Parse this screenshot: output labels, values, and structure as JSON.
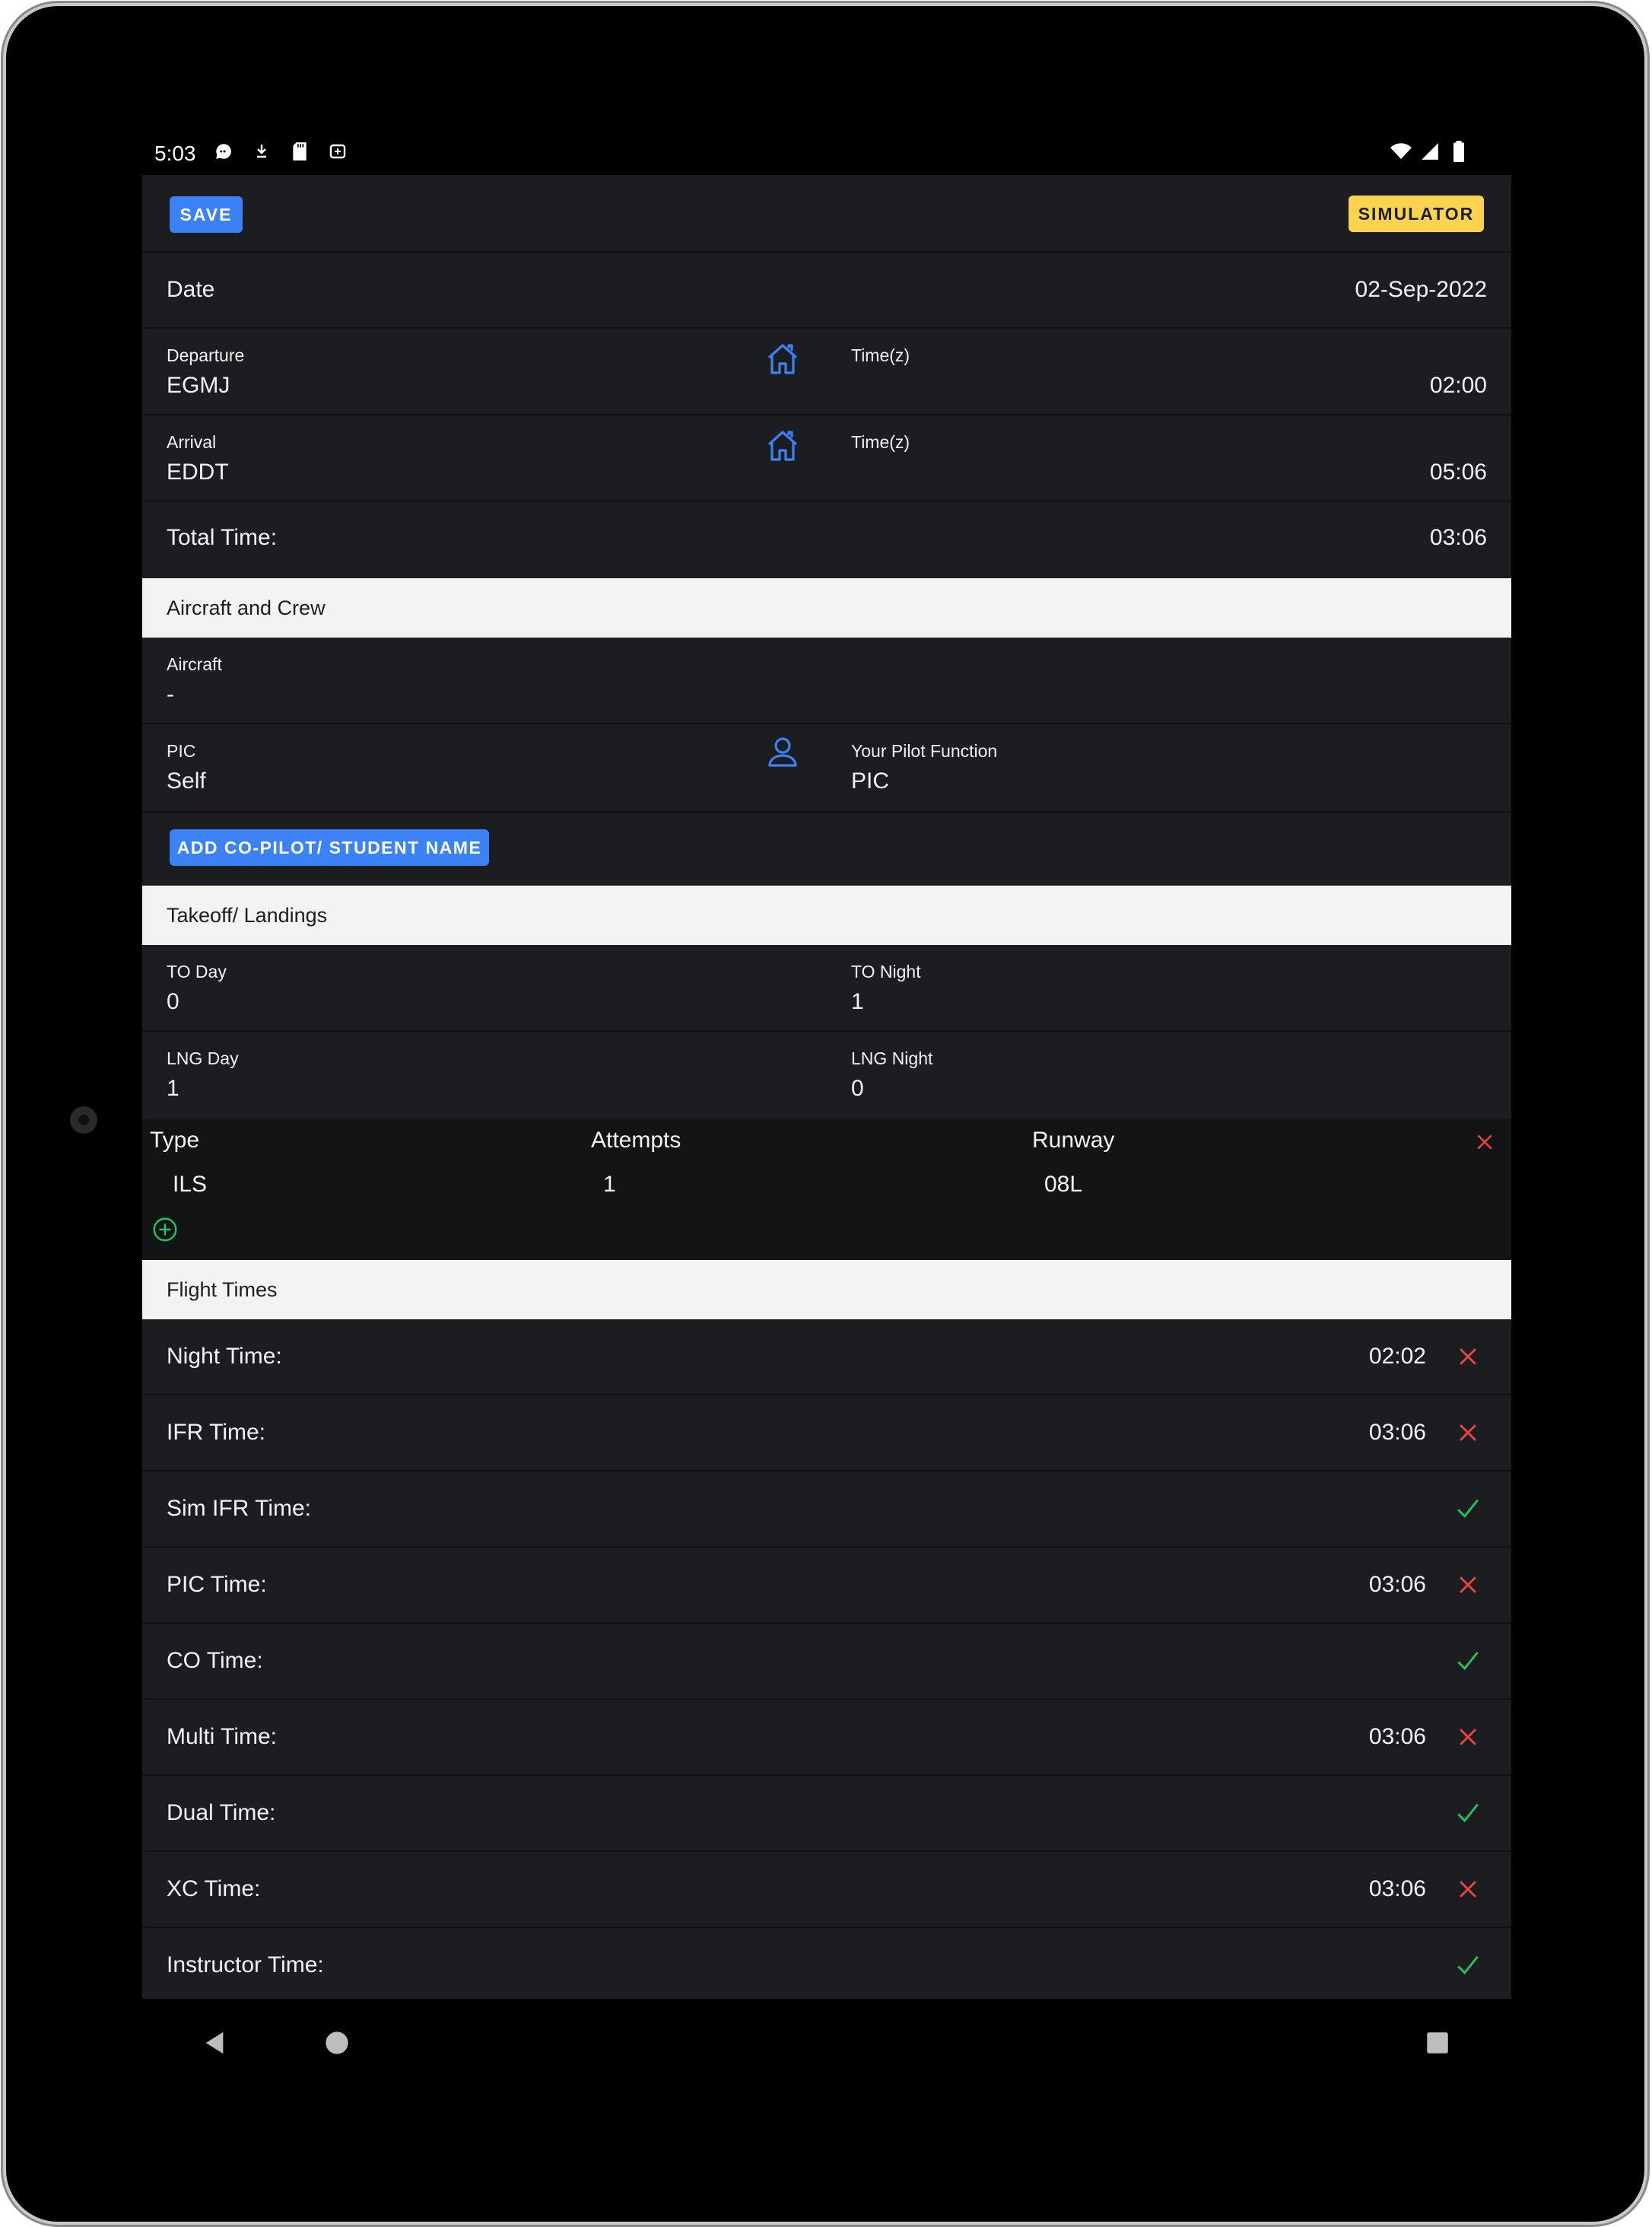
{
  "status_bar": {
    "time": "5:03",
    "icons": [
      "chat-icon",
      "download-icon",
      "sd-card-icon",
      "notification-icon"
    ],
    "right_icons": [
      "wifi-icon",
      "signal-icon",
      "battery-icon"
    ]
  },
  "toolbar": {
    "save_label": "SAVE",
    "simulator_label": "SIMULATOR"
  },
  "date": {
    "label": "Date",
    "value": "02-Sep-2022"
  },
  "departure": {
    "label": "Departure",
    "value": "EGMJ",
    "time_label": "Time(z)",
    "time_value": "02:00"
  },
  "arrival": {
    "label": "Arrival",
    "value": "EDDT",
    "time_label": "Time(z)",
    "time_value": "05:06"
  },
  "total_time": {
    "label": "Total Time:",
    "value": "03:06"
  },
  "sections": {
    "aircraft_crew": "Aircraft and Crew",
    "takeoff_landings": "Takeoff/ Landings",
    "flight_times": "Flight Times"
  },
  "aircraft": {
    "label": "Aircraft",
    "value": "-"
  },
  "pic": {
    "label": "PIC",
    "value": "Self",
    "function_label": "Your Pilot Function",
    "function_value": "PIC"
  },
  "add_copilot_label": "ADD CO-PILOT/ STUDENT NAME",
  "landings": {
    "to_day_label": "TO Day",
    "to_day_value": "0",
    "to_night_label": "TO Night",
    "to_night_value": "1",
    "lng_day_label": "LNG Day",
    "lng_day_value": "1",
    "lng_night_label": "LNG Night",
    "lng_night_value": "0"
  },
  "approaches": {
    "headers": {
      "type": "Type",
      "attempts": "Attempts",
      "runway": "Runway"
    },
    "rows": [
      {
        "type": "ILS",
        "attempts": "1",
        "runway": "08L"
      }
    ]
  },
  "flight_times": [
    {
      "label": "Night Time:",
      "value": "02:02",
      "mark": "x"
    },
    {
      "label": "IFR Time:",
      "value": "03:06",
      "mark": "x"
    },
    {
      "label": "Sim IFR Time:",
      "value": "",
      "mark": "check"
    },
    {
      "label": "PIC Time:",
      "value": "03:06",
      "mark": "x"
    },
    {
      "label": "CO Time:",
      "value": "",
      "mark": "check"
    },
    {
      "label": "Multi Time:",
      "value": "03:06",
      "mark": "x"
    },
    {
      "label": "Dual Time:",
      "value": "",
      "mark": "check"
    },
    {
      "label": "XC Time:",
      "value": "03:06",
      "mark": "x"
    },
    {
      "label": "Instructor Time:",
      "value": "",
      "mark": "check"
    }
  ],
  "colors": {
    "background": "#1c1d20",
    "section_bg": "#f3f3f4",
    "primary_blue": "#3b82f6",
    "simulator_yellow": "#fcd34d",
    "remove_red": "#ef4444",
    "check_green": "#22c55e"
  }
}
